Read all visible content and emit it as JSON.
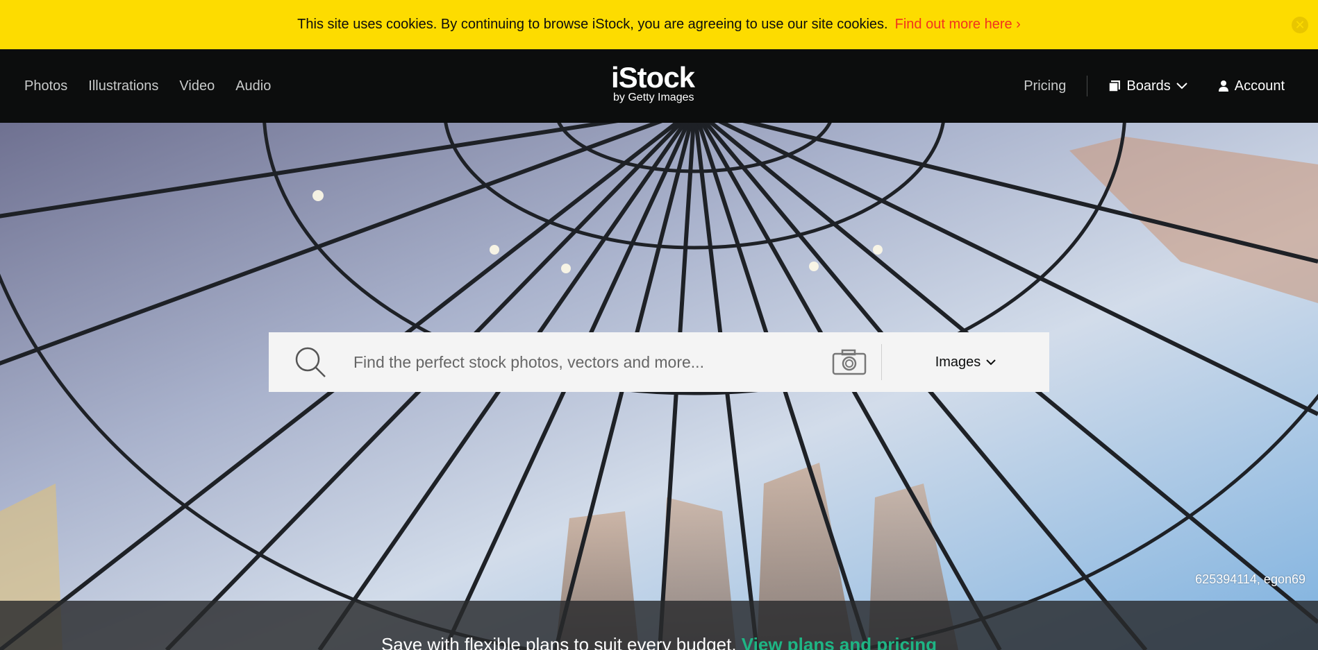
{
  "cookie_banner": {
    "message": "This site uses cookies. By continuing to browse iStock, you are agreeing to use our site cookies.",
    "link": "Find out more here ›",
    "close_icon": "close-icon"
  },
  "nav": {
    "left": [
      "Photos",
      "Illustrations",
      "Video",
      "Audio"
    ],
    "logo_main": "iStock",
    "logo_sub": "by Getty Images",
    "pricing": "Pricing",
    "boards": "Boards",
    "account": "Account"
  },
  "search": {
    "placeholder": "Find the perfect stock photos, vectors and more...",
    "value": "",
    "type_selected": "Images",
    "icons": [
      "search-icon",
      "camera-icon",
      "chevron-down-icon"
    ]
  },
  "hero": {
    "image_credit": "625394114, egon69",
    "promo_text": "Save with flexible plans to suit every budget.",
    "promo_link": "View plans and pricing"
  },
  "colors": {
    "banner": "#fddc00",
    "banner_link": "#f2321e",
    "header_bg": "#0c0d0d",
    "promo_link": "#1eb584"
  }
}
